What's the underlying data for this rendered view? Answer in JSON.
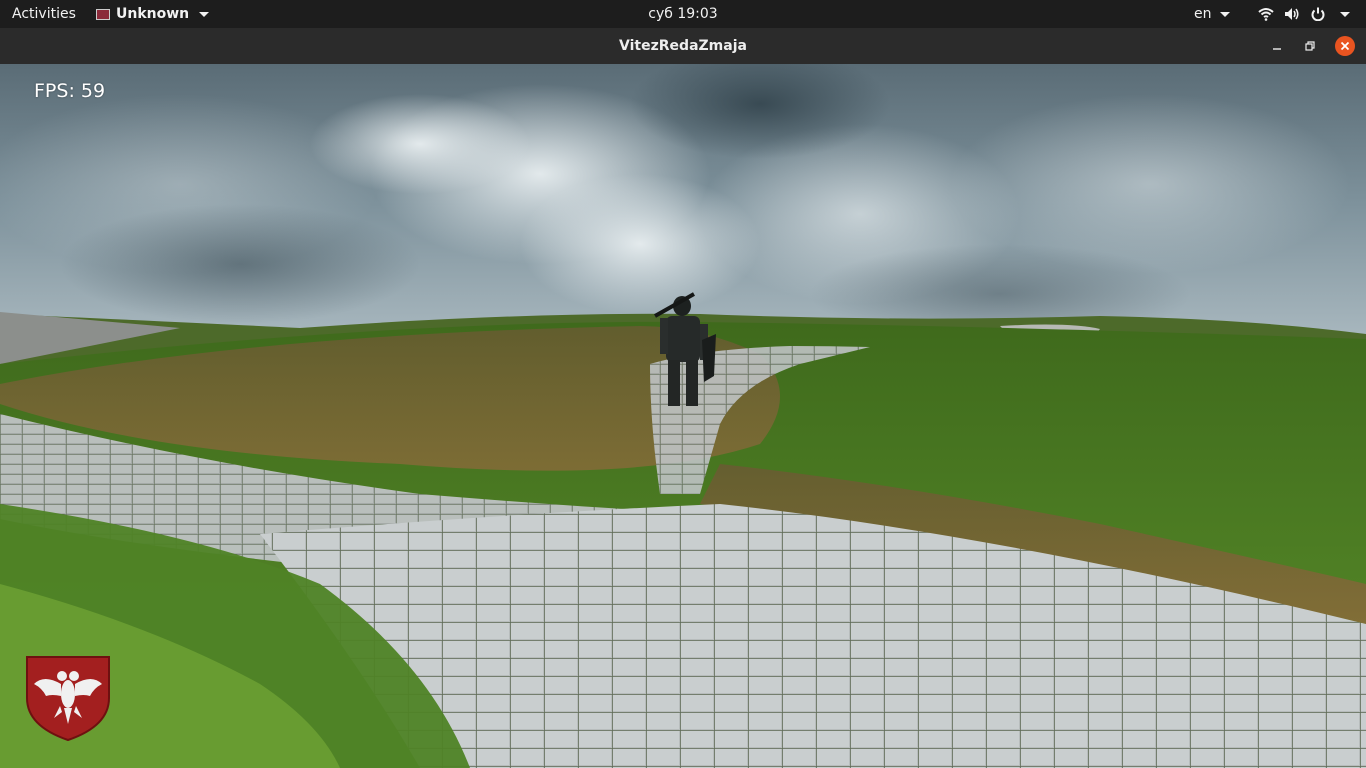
{
  "topbar": {
    "activities_label": "Activities",
    "app_menu_label": "Unknown",
    "clock": "суб 19:03",
    "lang": "en",
    "icons": [
      "wifi-icon",
      "volume-icon",
      "power-icon"
    ]
  },
  "window": {
    "title": "VitezRedaZmaja",
    "close_color": "#e95420"
  },
  "game": {
    "fps_label": "FPS: 59"
  }
}
